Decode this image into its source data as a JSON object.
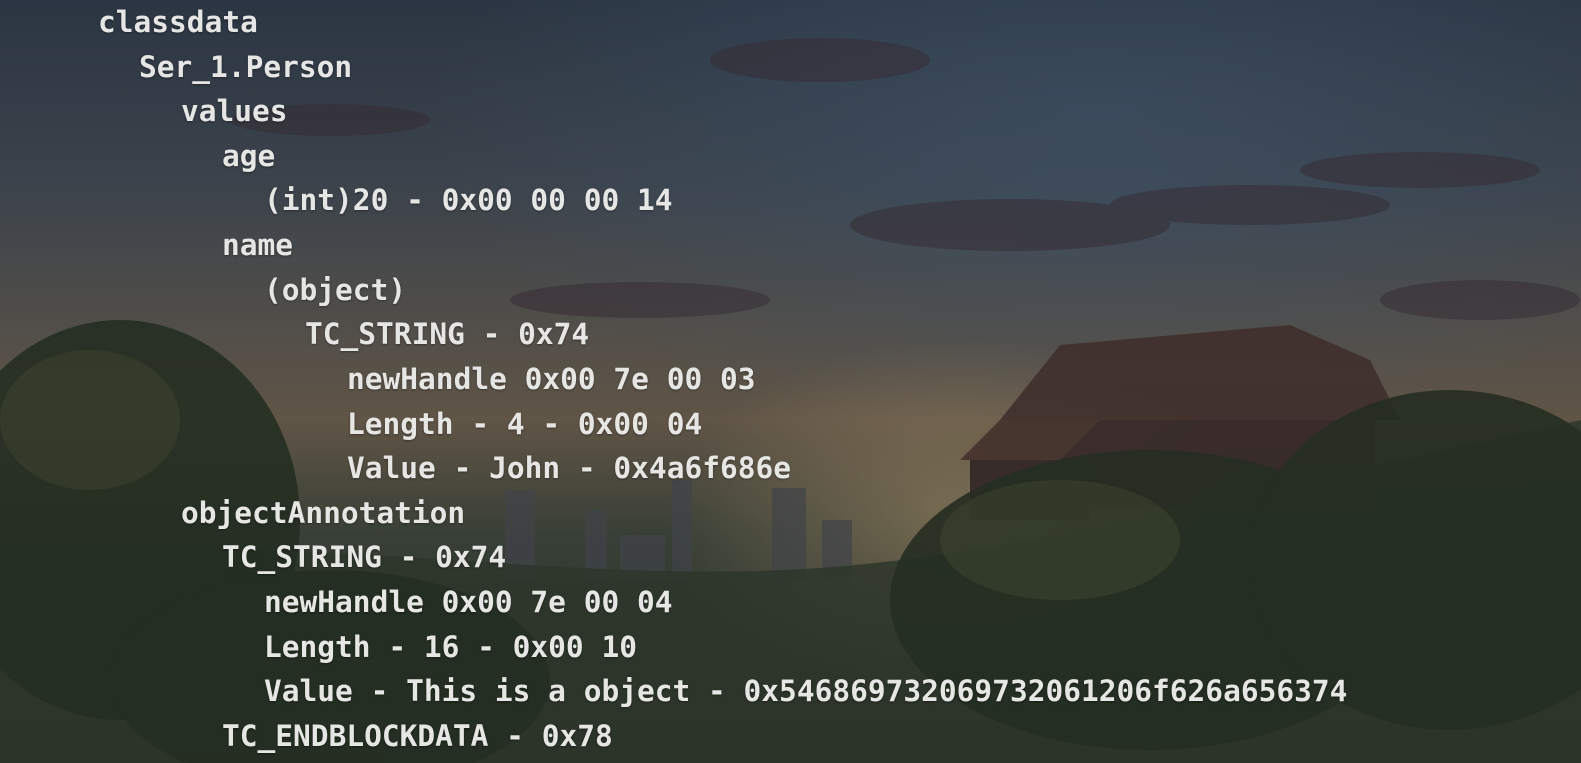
{
  "terminal": {
    "lines": [
      {
        "indent": 2,
        "text": "classdata"
      },
      {
        "indent": 3,
        "text": "Ser_1.Person"
      },
      {
        "indent": 4,
        "text": "values"
      },
      {
        "indent": 5,
        "text": "age"
      },
      {
        "indent": 6,
        "text": "(int)20 - 0x00 00 00 14"
      },
      {
        "indent": 5,
        "text": "name"
      },
      {
        "indent": 6,
        "text": "(object)"
      },
      {
        "indent": 7,
        "text": "TC_STRING - 0x74"
      },
      {
        "indent": 8,
        "text": "newHandle 0x00 7e 00 03"
      },
      {
        "indent": 8,
        "text": "Length - 4 - 0x00 04"
      },
      {
        "indent": 8,
        "text": "Value - John - 0x4a6f686e"
      },
      {
        "indent": 4,
        "text": "objectAnnotation"
      },
      {
        "indent": 5,
        "text": "TC_STRING - 0x74"
      },
      {
        "indent": 6,
        "text": "newHandle 0x00 7e 00 04"
      },
      {
        "indent": 6,
        "text": "Length - 16 - 0x00 10"
      },
      {
        "indent": 6,
        "text": "Value - This is a object - 0x546869732069732061206f626a656374"
      },
      {
        "indent": 5,
        "text": "TC_ENDBLOCKDATA - 0x78"
      }
    ]
  }
}
